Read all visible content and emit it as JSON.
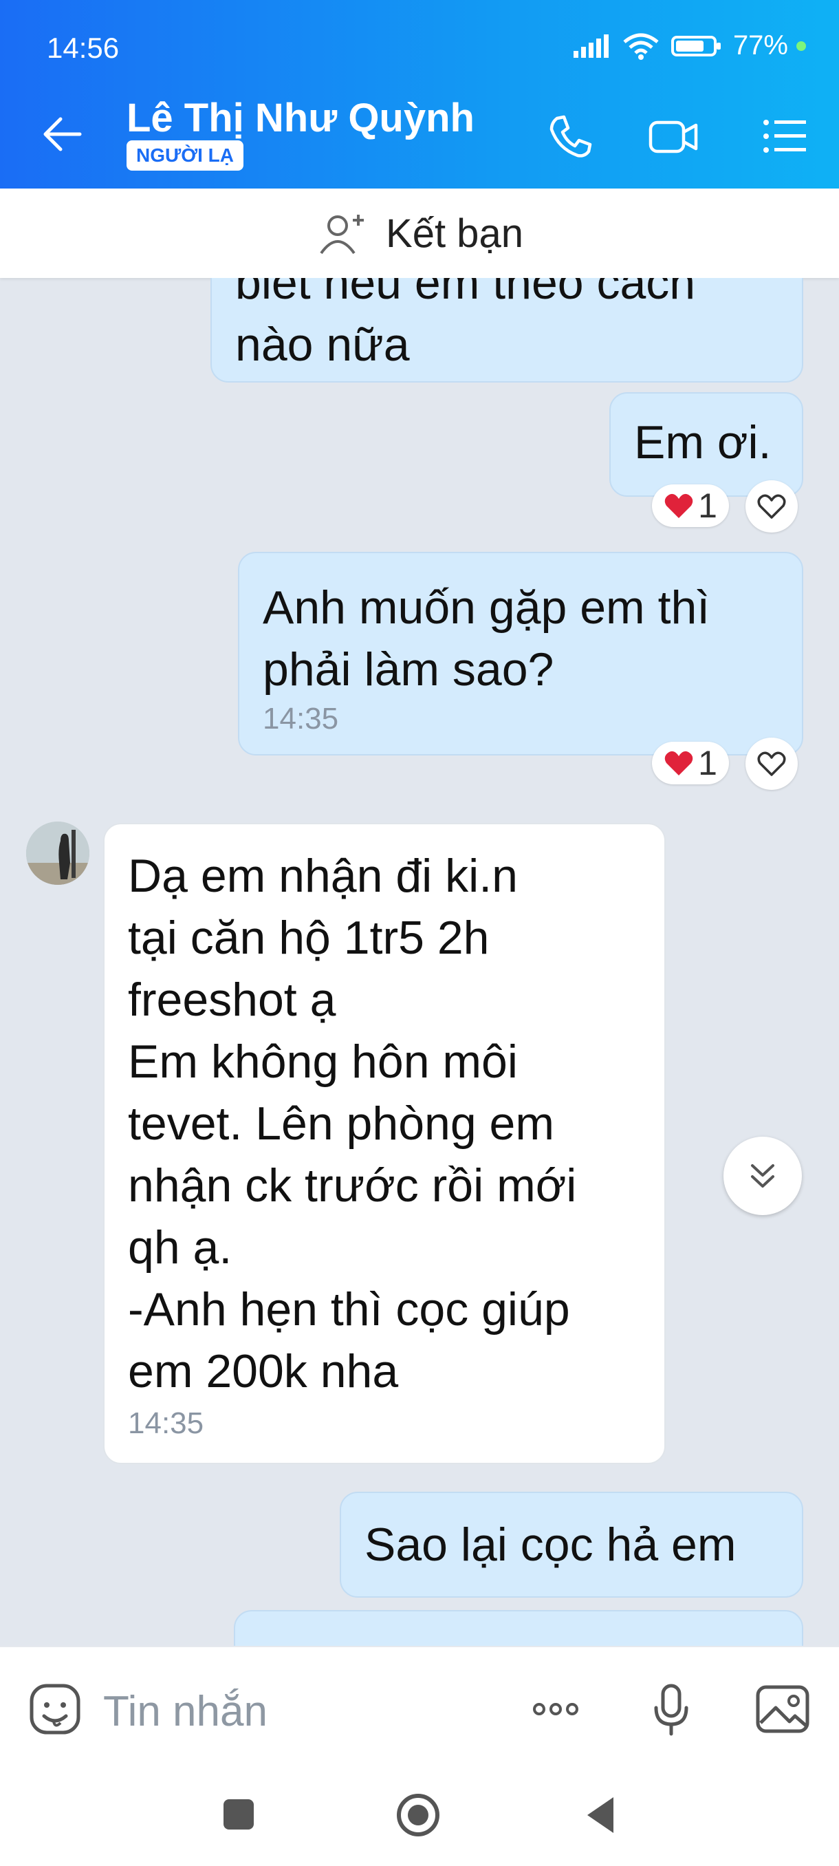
{
  "status_bar": {
    "time": "14:56",
    "battery": "77%",
    "battery_level": 0.77
  },
  "header": {
    "title": "Lê Thị Như Quỳnh",
    "badge": "NGƯỜI LẠ",
    "icons": [
      "back-arrow-icon",
      "phone-icon",
      "video-call-icon",
      "menu-list-icon"
    ]
  },
  "friend_bar": {
    "label": "Kết bạn",
    "icon": "add-friend-icon"
  },
  "messages": [
    {
      "from": "me",
      "lines": [
        "biết nếu em theo cách",
        "nào nữa"
      ]
    },
    {
      "from": "me",
      "lines": [
        "Em ơi."
      ],
      "reaction_count": "1"
    },
    {
      "from": "me",
      "lines": [
        "Anh muốn gặp em thì",
        "phải làm sao?"
      ],
      "time": "14:35",
      "reaction_count": "1"
    },
    {
      "from": "them",
      "lines": [
        "Dạ em nhận đi ki.n",
        "tại căn hộ 1tr5 2h",
        "freeshot ạ",
        "Em không hôn môi",
        "tevet. Lên phòng em",
        "nhận ck trước rồi mới",
        "qh ạ.",
        "-Anh hẹn thì cọc giúp",
        "em 200k nha"
      ],
      "time": "14:35"
    },
    {
      "from": "me",
      "lines": [
        "Sao lại cọc hả em"
      ]
    }
  ],
  "composer": {
    "placeholder": "Tin nhắn"
  },
  "colors": {
    "header_start": "#1a6df5",
    "header_end": "#0fb1f5",
    "outgoing_bubble": "#d4ebfd",
    "incoming_bubble": "#ffffff",
    "chat_bg": "#e2e7ee",
    "heart": "#e0223a"
  }
}
